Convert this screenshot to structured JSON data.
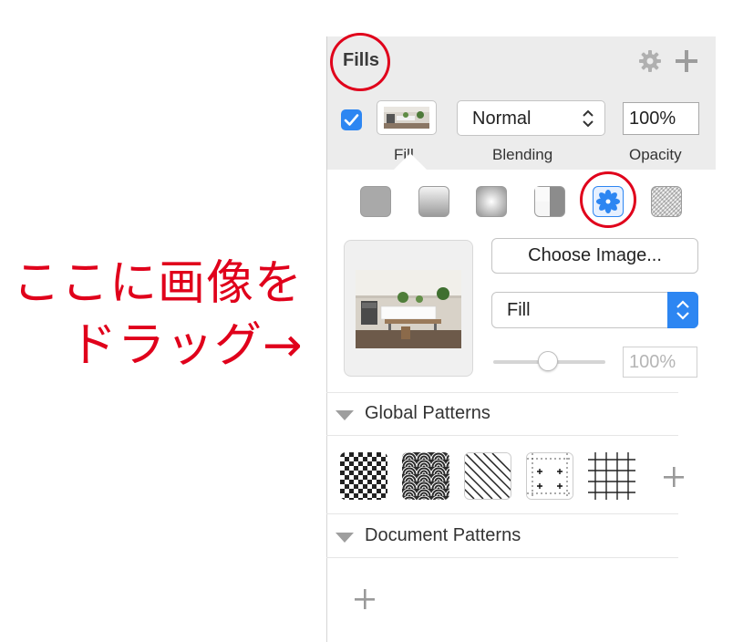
{
  "inspector": {
    "title": "Fills",
    "fill_label": "Fill",
    "blending_label": "Blending",
    "opacity_label": "Opacity",
    "blend_mode": "Normal",
    "opacity_value": "100%",
    "fill_enabled": true
  },
  "fill_types": [
    "solid-fill-icon",
    "linear-gradient-icon",
    "radial-gradient-icon",
    "angular-gradient-icon",
    "pattern-fill-icon",
    "noise-fill-icon"
  ],
  "image_fill": {
    "choose_image_label": "Choose Image...",
    "mode_value": "Fill",
    "tint_value": "100%"
  },
  "global_patterns": {
    "title": "Global Patterns",
    "items": [
      "checkerboard-pattern",
      "seigaiha-pattern",
      "diagonal-lines-pattern",
      "dotted-crosshair-pattern",
      "grid-pattern"
    ]
  },
  "document_patterns": {
    "title": "Document Patterns"
  },
  "annotation": {
    "line1": "ここに画像を",
    "line2": "ドラッグ→"
  },
  "colors": {
    "accent_blue": "#2d86f2",
    "annotation_red": "#e0001b",
    "panel_bg": "#ececec"
  }
}
